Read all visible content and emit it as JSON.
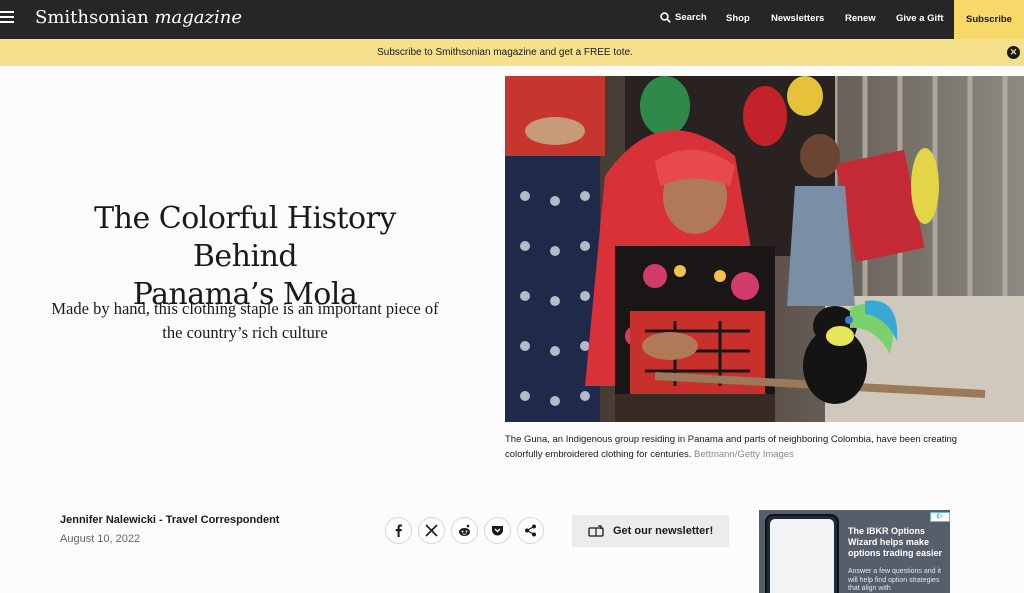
{
  "nav": {
    "logo_main": "Smithsonian",
    "logo_italic": "magazine",
    "search_label": "Search",
    "links": [
      "Shop",
      "Newsletters",
      "Renew",
      "Give a Gift"
    ],
    "subscribe_label": "Subscribe"
  },
  "promo": {
    "text": "Subscribe to Smithsonian magazine and get a FREE tote.",
    "close_icon": "close-icon"
  },
  "article": {
    "headline_line1": "The Colorful History Behind",
    "headline_line2": "Panama’s Mola",
    "dek_line1": "Made by hand, this clothing staple is an important piece of",
    "dek_line2": "the country’s rich culture",
    "image_caption_line1": "The Guna, an Indigenous group residing in Panama and parts of neighboring Colombia, have been creating",
    "image_caption_line2": "colorfully embroidered clothing for centuries.",
    "image_credit": "Bettmann/Getty Images",
    "author": "Jennifer Nalewicki - Travel Correspondent",
    "date": "August 10, 2022"
  },
  "share": {
    "icons": [
      "facebook-icon",
      "x-icon",
      "reddit-icon",
      "pocket-icon",
      "share-icon"
    ]
  },
  "newsletter_button": "Get our newsletter!",
  "ad": {
    "title": "The IBKR Options Wizard helps make options trading easier",
    "body": "Answer a few questions and it will help find option strategies that align with",
    "badge": "i▷"
  },
  "colors": {
    "nav_bg": "#262626",
    "accent_yellow": "#f7d96a",
    "promo_bg": "#f6e08c"
  }
}
